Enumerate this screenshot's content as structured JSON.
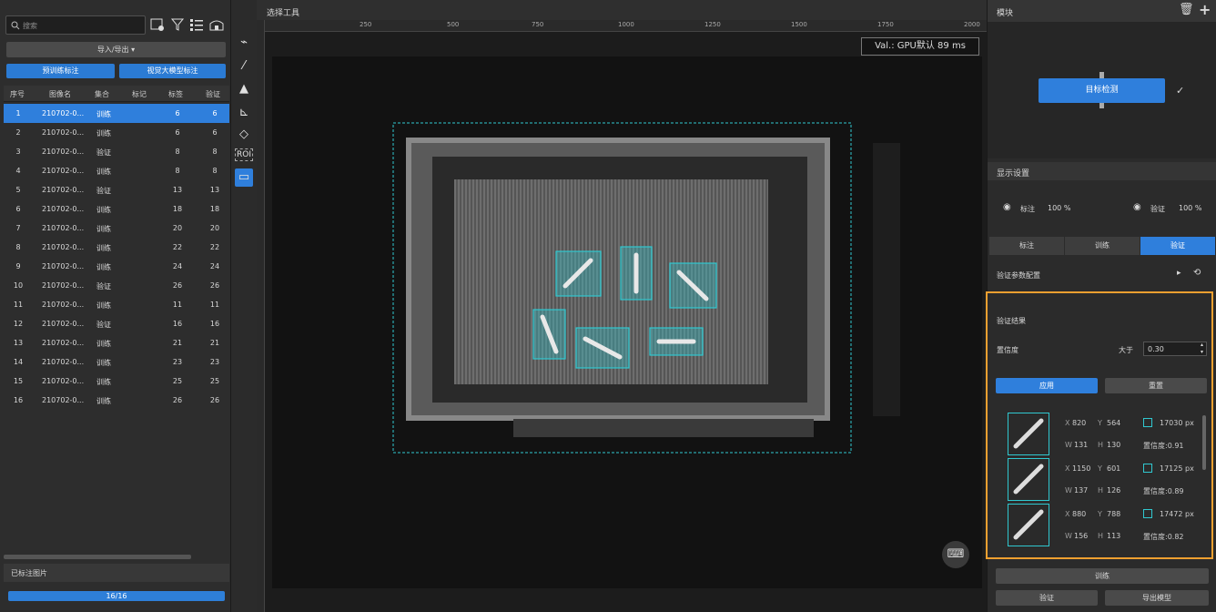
{
  "left": {
    "search_placeholder": "搜索",
    "import_export": "导入/导出 ▾",
    "btn_pretrain": "预训练标注",
    "btn_vlm": "视觉大模型标注",
    "columns": [
      "序号",
      "图像名",
      "集合",
      "标记",
      "标签",
      "验证"
    ],
    "rows": [
      {
        "n": "1",
        "name": "210702-0...",
        "set": "训练",
        "tag": "6",
        "val": "6"
      },
      {
        "n": "2",
        "name": "210702-0...",
        "set": "训练",
        "tag": "6",
        "val": "6"
      },
      {
        "n": "3",
        "name": "210702-0...",
        "set": "验证",
        "tag": "8",
        "val": "8"
      },
      {
        "n": "4",
        "name": "210702-0...",
        "set": "训练",
        "tag": "8",
        "val": "8"
      },
      {
        "n": "5",
        "name": "210702-0...",
        "set": "验证",
        "tag": "13",
        "val": "13"
      },
      {
        "n": "6",
        "name": "210702-0...",
        "set": "训练",
        "tag": "18",
        "val": "18"
      },
      {
        "n": "7",
        "name": "210702-0...",
        "set": "训练",
        "tag": "20",
        "val": "20"
      },
      {
        "n": "8",
        "name": "210702-0...",
        "set": "训练",
        "tag": "22",
        "val": "22"
      },
      {
        "n": "9",
        "name": "210702-0...",
        "set": "训练",
        "tag": "24",
        "val": "24"
      },
      {
        "n": "10",
        "name": "210702-0...",
        "set": "验证",
        "tag": "26",
        "val": "26"
      },
      {
        "n": "11",
        "name": "210702-0...",
        "set": "训练",
        "tag": "11",
        "val": "11"
      },
      {
        "n": "12",
        "name": "210702-0...",
        "set": "验证",
        "tag": "16",
        "val": "16"
      },
      {
        "n": "13",
        "name": "210702-0...",
        "set": "训练",
        "tag": "21",
        "val": "21"
      },
      {
        "n": "14",
        "name": "210702-0...",
        "set": "训练",
        "tag": "23",
        "val": "23"
      },
      {
        "n": "15",
        "name": "210702-0...",
        "set": "训练",
        "tag": "25",
        "val": "25"
      },
      {
        "n": "16",
        "name": "210702-0...",
        "set": "训练",
        "tag": "26",
        "val": "26"
      }
    ],
    "labeled_images": "已标注图片",
    "progress": "16/16",
    "progress_value": 1.0
  },
  "canvas": {
    "title": "选择工具",
    "ruler_ticks": [
      "250",
      "500",
      "750",
      "1000",
      "1250",
      "1500",
      "1750",
      "2000"
    ],
    "val_label": "Val.: ",
    "val_text": "GPU默认 89 ms",
    "tool_icons": [
      "polygon-icon",
      "magic-wand-icon",
      "stamp-icon",
      "ruler-icon",
      "eraser-icon",
      "roi-icon",
      "select-box-icon"
    ],
    "roi_label": "ROI"
  },
  "right": {
    "module_title": "模块",
    "node_label": "目标检测",
    "display_settings": "显示设置",
    "annot_label": "标注",
    "annot_pct": "100 %",
    "verify_label": "验证",
    "verify_pct": "100 %",
    "tabs": [
      "标注",
      "训练",
      "验证"
    ],
    "active_tab": 2,
    "verify_config": "验证参数配置",
    "result_title": "验证结果",
    "confidence_label": "置信度",
    "greater_than": "大于",
    "threshold": "0.30",
    "apply": "应用",
    "reset": "重置",
    "results": [
      {
        "x": "820",
        "y": "564",
        "w": "131",
        "h": "130",
        "area": "17030 px",
        "conf": "置信度:0.91"
      },
      {
        "x": "1150",
        "y": "601",
        "w": "137",
        "h": "126",
        "area": "17125 px",
        "conf": "置信度:0.89"
      },
      {
        "x": "880",
        "y": "788",
        "w": "156",
        "h": "113",
        "area": "17472 px",
        "conf": "置信度:0.82"
      }
    ],
    "train_btn": "训练",
    "verify_btn": "验证",
    "export_btn": "导出模型"
  },
  "colors": {
    "accent": "#2f7fdc",
    "highlight": "#f0a030",
    "detect": "#30c8d0"
  }
}
